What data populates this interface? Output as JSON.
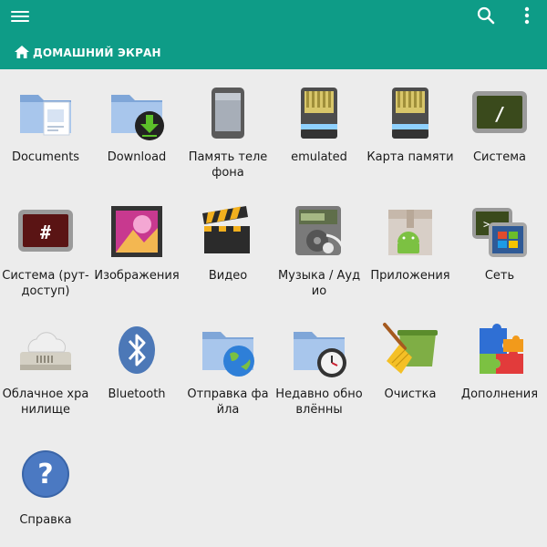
{
  "header": {
    "breadcrumb": "ДОМАШНИЙ ЭКРАН",
    "color": "#0e9c87",
    "menu_icon": "hamburger-menu-icon",
    "search_icon": "search-icon",
    "more_icon": "more-vertical-icon",
    "home_icon": "home-icon"
  },
  "items": [
    {
      "label": "Documents",
      "icon": "documents-folder-icon"
    },
    {
      "label": "Download",
      "icon": "download-folder-icon"
    },
    {
      "label": "Память телефона",
      "icon": "phone-memory-icon"
    },
    {
      "label": "emulated",
      "icon": "sd-card-icon"
    },
    {
      "label": "Карта памяти",
      "icon": "sd-card-icon"
    },
    {
      "label": "Система",
      "icon": "system-root-icon"
    },
    {
      "label": "Система (рут-доступ)",
      "icon": "root-access-icon"
    },
    {
      "label": "Изображения",
      "icon": "images-icon"
    },
    {
      "label": "Видео",
      "icon": "video-clapper-icon"
    },
    {
      "label": "Музыка / Аудио",
      "icon": "music-audio-icon"
    },
    {
      "label": "Приложения",
      "icon": "apps-android-box-icon"
    },
    {
      "label": "Сеть",
      "icon": "network-icon"
    },
    {
      "label": "Облачное хранилище",
      "icon": "cloud-storage-icon"
    },
    {
      "label": "Bluetooth",
      "icon": "bluetooth-icon"
    },
    {
      "label": "Отправка файла",
      "icon": "send-file-globe-icon"
    },
    {
      "label": "Недавно обновлённы",
      "icon": "recent-clock-folder-icon"
    },
    {
      "label": "Очистка",
      "icon": "cleanup-broom-icon"
    },
    {
      "label": "Дополнения",
      "icon": "addons-puzzle-icon"
    },
    {
      "label": "Справка",
      "icon": "help-icon"
    }
  ]
}
